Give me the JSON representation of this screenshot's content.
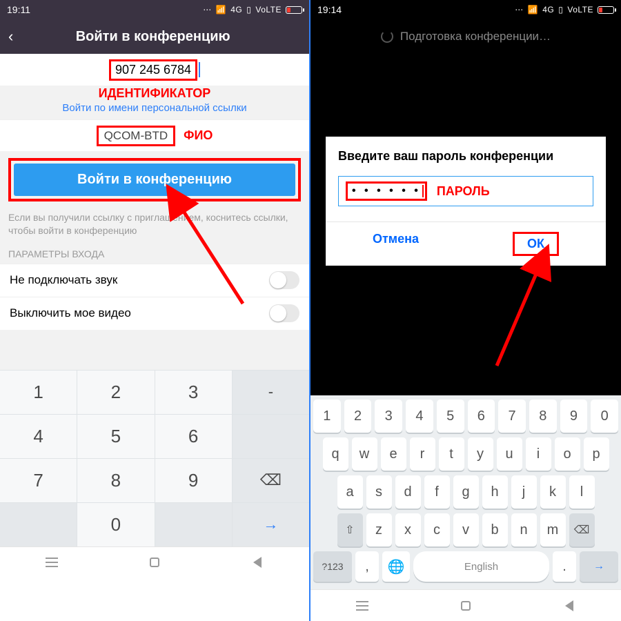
{
  "left": {
    "status_time": "19:11",
    "status_net": "4G",
    "status_volte": "VoLTE",
    "header_title": "Войти в конференцию",
    "meeting_id": "907 245 6784",
    "annot_id": "ИДЕНТИФИКАТОР",
    "personal_link": "Войти по имени персональной ссылки",
    "display_name": "QCOM-BTD",
    "annot_name": "ФИО",
    "join_button": "Войти в конференцию",
    "hint": "Если вы получили ссылку с приглашением, коснитесь ссылки, чтобы войти в конференцию",
    "options_title": "ПАРАМЕТРЫ ВХОДА",
    "opt_audio": "Не подключать звук",
    "opt_video": "Выключить мое видео",
    "numkeys": [
      [
        "1",
        "2",
        "3",
        "-"
      ],
      [
        "4",
        "5",
        "6",
        "  "
      ],
      [
        "7",
        "8",
        "9",
        "⌫"
      ],
      [
        "",
        "0",
        "",
        "→"
      ]
    ]
  },
  "right": {
    "status_time": "19:14",
    "status_net": "4G",
    "status_volte": "VoLTE",
    "loading": "Подготовка конференции…",
    "dialog_title": "Введите ваш пароль конференции",
    "password_masked": "• • • • • •",
    "annot_pw": "ПАРОЛЬ",
    "cancel": "Отмена",
    "ok": "ОК",
    "row_nums": [
      "1",
      "2",
      "3",
      "4",
      "5",
      "6",
      "7",
      "8",
      "9",
      "0"
    ],
    "row_q": [
      "q",
      "w",
      "e",
      "r",
      "t",
      "y",
      "u",
      "i",
      "o",
      "p"
    ],
    "row_a": [
      "a",
      "s",
      "d",
      "f",
      "g",
      "h",
      "j",
      "k",
      "l"
    ],
    "shift": "⇧",
    "row_z": [
      "z",
      "x",
      "c",
      "v",
      "b",
      "n",
      "m"
    ],
    "bksp": "⌫",
    "sym": "?123",
    "comma": ",",
    "globe": "🌐",
    "space": "English",
    "period": ".",
    "enter": "→"
  }
}
